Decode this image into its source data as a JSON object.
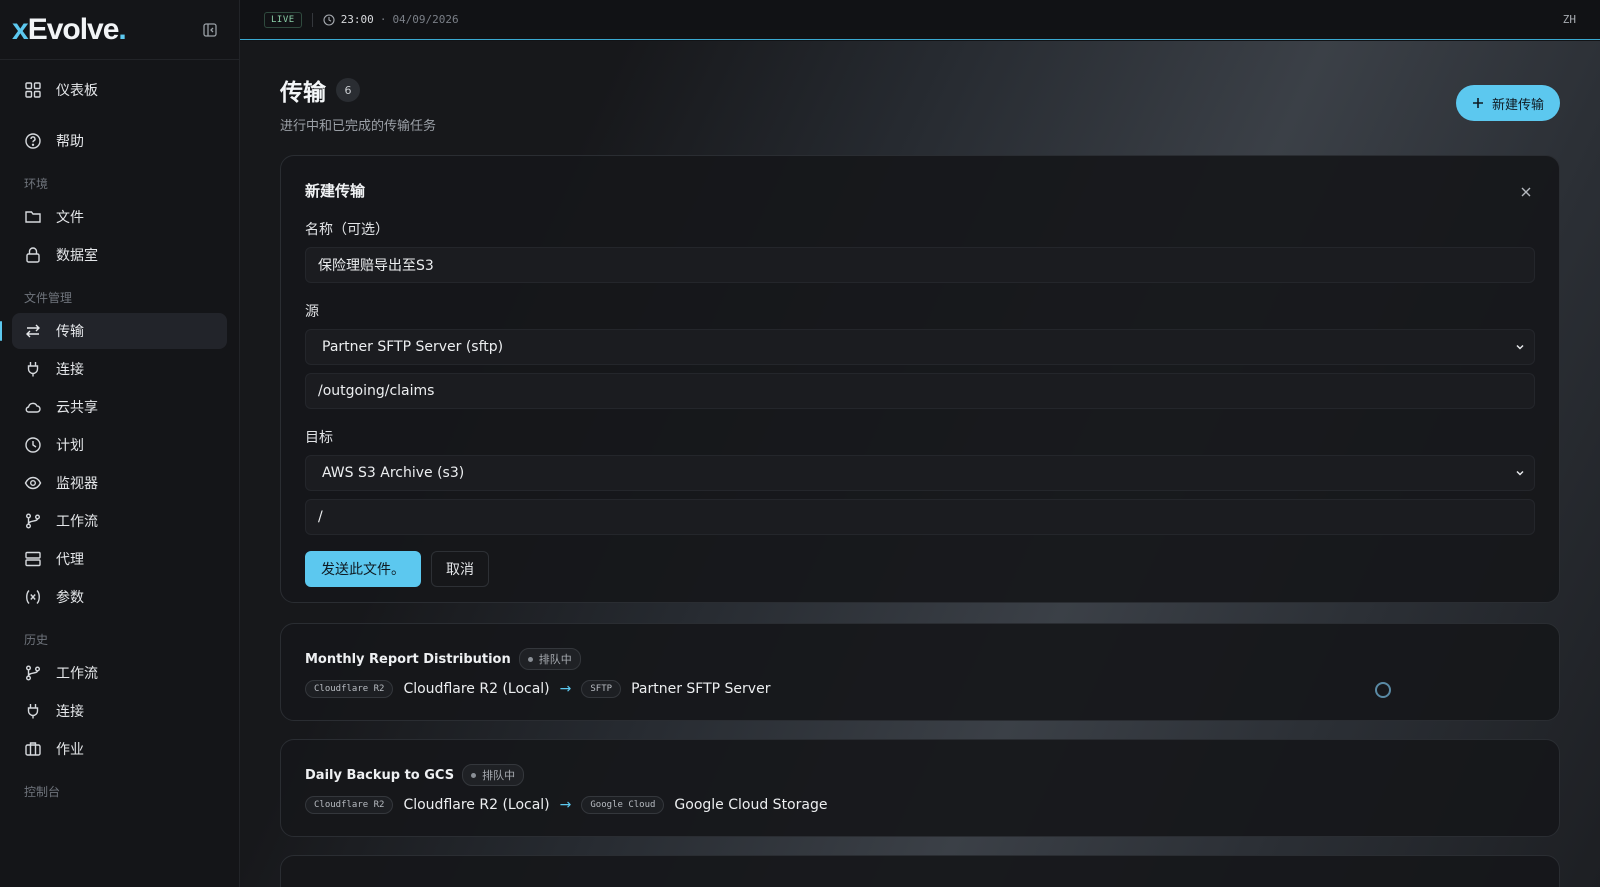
{
  "brand": {
    "prefix": "x",
    "name": "Evolve",
    "suffix": "."
  },
  "topbar": {
    "live": "LIVE",
    "time": "23:00",
    "date_sep": "·",
    "date": "04/09/2026",
    "lang": "ZH"
  },
  "sidebar": {
    "top": [
      {
        "label": "仪表板",
        "icon": "dashboard-icon"
      },
      {
        "label": "帮助",
        "icon": "help-icon"
      }
    ],
    "sections": [
      {
        "title": "环境",
        "items": [
          {
            "label": "文件",
            "icon": "folder-icon"
          },
          {
            "label": "数据室",
            "icon": "lock-icon"
          }
        ]
      },
      {
        "title": "文件管理",
        "items": [
          {
            "label": "传输",
            "icon": "transfer-icon",
            "active": true
          },
          {
            "label": "连接",
            "icon": "plug-icon"
          },
          {
            "label": "云共享",
            "icon": "cloud-icon"
          },
          {
            "label": "计划",
            "icon": "clock-icon"
          },
          {
            "label": "监视器",
            "icon": "eye-icon"
          },
          {
            "label": "工作流",
            "icon": "workflow-icon"
          },
          {
            "label": "代理",
            "icon": "server-icon"
          },
          {
            "label": "参数",
            "icon": "variable-icon"
          }
        ]
      },
      {
        "title": "历史",
        "items": [
          {
            "label": "工作流",
            "icon": "workflow-icon"
          },
          {
            "label": "连接",
            "icon": "plug-icon"
          },
          {
            "label": "作业",
            "icon": "briefcase-icon"
          }
        ]
      },
      {
        "title": "控制台",
        "items": []
      }
    ]
  },
  "page": {
    "title": "传输",
    "count": "6",
    "subtitle": "进行中和已完成的传输任务",
    "new_button": "新建传输"
  },
  "form": {
    "title": "新建传输",
    "name_label": "名称（可选）",
    "name_value": "保险理赔导出至S3",
    "source_label": "源",
    "source_select": "Partner SFTP Server (sftp)",
    "source_path": "/outgoing/claims",
    "target_label": "目标",
    "target_select": "AWS S3 Archive (s3)",
    "target_path": "/",
    "submit": "发送此文件。",
    "cancel": "取消"
  },
  "transfers": [
    {
      "name": "Monthly Report Distribution",
      "status": "排队中",
      "src_tag": "Cloudflare R2",
      "src": "Cloudflare R2 (Local)",
      "dst_tag": "SFTP",
      "dst": "Partner SFTP Server"
    },
    {
      "name": "Daily Backup to GCS",
      "status": "排队中",
      "src_tag": "Cloudflare R2",
      "src": "Cloudflare R2 (Local)",
      "dst_tag": "Google Cloud",
      "dst": "Google Cloud Storage"
    }
  ],
  "colors": {
    "accent": "#5cc8ef",
    "background": "#121316"
  }
}
